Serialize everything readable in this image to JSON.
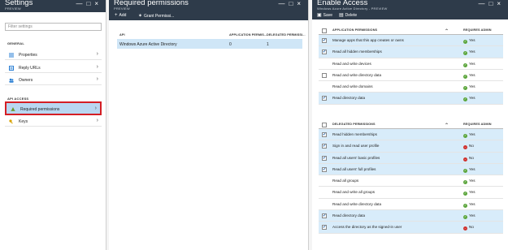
{
  "settings": {
    "title": "Settings",
    "subtitle": "PREVIEW",
    "controls": [
      "—",
      "□",
      "×"
    ],
    "search_placeholder": "Filter settings",
    "general_label": "GENERAL",
    "api_access_label": "API ACCESS",
    "items": [
      {
        "label": "Properties",
        "icon": "properties-icon",
        "icon_color": "#2a7fd4"
      },
      {
        "label": "Reply URLs",
        "icon": "reply-urls-icon",
        "icon_color": "#2a7fd4"
      },
      {
        "label": "Owners",
        "icon": "owners-icon",
        "icon_color": "#2a7fd4"
      },
      {
        "label": "Required permissions",
        "icon": "required-permissions-icon",
        "icon_color": "#6a9a2a"
      },
      {
        "label": "Keys",
        "icon": "key-icon",
        "icon_color": "#d8a200"
      }
    ],
    "chevron": "›"
  },
  "required": {
    "title": "Required permissions",
    "subtitle": "PREVIEW",
    "controls": [
      "—",
      "□",
      "×"
    ],
    "add_label": "Add",
    "grant_label": "Grant Permissi...",
    "columns": [
      "API",
      "APPLICATION PERMIS...",
      "DELEGATED PERMISSI..."
    ],
    "rows": [
      {
        "api": "Windows Azure Active Directory",
        "app": "0",
        "delegated": "1"
      }
    ]
  },
  "enable": {
    "title": "Enable Access",
    "subtitle": "Windows Azure Active Directory - PREVIEW",
    "controls": [
      "—",
      "□",
      "×"
    ],
    "save_label": "Save",
    "delete_label": "Delete",
    "app_section": {
      "header": "APPLICATION PERMISSIONS",
      "admin_header": "REQUIRES ADMIN",
      "rows": [
        {
          "name": "Manage apps that this app creates or owns",
          "checked": true,
          "admin": "Yes"
        },
        {
          "name": "Read all hidden memberships",
          "checked": true,
          "admin": "Yes"
        },
        {
          "name": "Read and write devices",
          "checked": false,
          "admin": "Yes"
        },
        {
          "name": "Read and write directory data",
          "checked": false,
          "admin": "Yes"
        },
        {
          "name": "Read and write domains",
          "checked": false,
          "admin": "Yes"
        },
        {
          "name": "Read directory data",
          "checked": true,
          "admin": "Yes"
        }
      ]
    },
    "delegated_section": {
      "header": "DELEGATED PERMISSIONS",
      "admin_header": "REQUIRES ADMIN",
      "rows": [
        {
          "name": "Read hidden memberships",
          "checked": true,
          "admin": "Yes"
        },
        {
          "name": "Sign in and read user profile",
          "checked": true,
          "admin": "No"
        },
        {
          "name": "Read all users' basic profiles",
          "checked": true,
          "admin": "No"
        },
        {
          "name": "Read all users' full profiles",
          "checked": true,
          "admin": "Yes"
        },
        {
          "name": "Read all groups",
          "checked": false,
          "admin": "Yes"
        },
        {
          "name": "Read and write all groups",
          "checked": false,
          "admin": "Yes"
        },
        {
          "name": "Read and write directory data",
          "checked": false,
          "admin": "Yes"
        },
        {
          "name": "Read directory data",
          "checked": true,
          "admin": "Yes"
        },
        {
          "name": "Access the directory as the signed-in user",
          "checked": true,
          "admin": "No"
        }
      ]
    },
    "check_glyph": "✔",
    "caret": "⌃"
  },
  "colors": {
    "header_bg": "#2e3b4a",
    "selected_bg": "#b9d7f1",
    "highlight_border": "#d41e24",
    "yes": "#5ba53b",
    "no": "#d0312d"
  }
}
